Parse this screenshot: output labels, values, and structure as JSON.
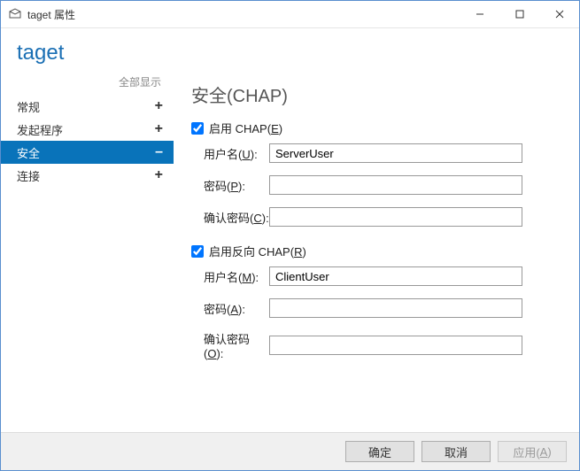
{
  "window": {
    "title": "taget 属性"
  },
  "heading": "taget",
  "sidebar": {
    "show_all": "全部显示",
    "items": [
      {
        "label": "常规",
        "toggle": "+",
        "active": false
      },
      {
        "label": "发起程序",
        "toggle": "+",
        "active": false
      },
      {
        "label": "安全",
        "toggle": "–",
        "active": true
      },
      {
        "label": "连接",
        "toggle": "+",
        "active": false
      }
    ]
  },
  "content": {
    "section_title": "安全(CHAP)",
    "chap": {
      "enable_label_pre": "启用 CHAP(",
      "enable_key": "E",
      "enable_label_post": ")",
      "enabled": true,
      "username_label_pre": "用户名(",
      "username_key": "U",
      "username_label_post": "):",
      "username_value": "ServerUser",
      "password_label_pre": "密码(",
      "password_key": "P",
      "password_label_post": "):",
      "password_value": "",
      "confirm_label_pre": "确认密码(",
      "confirm_key": "C",
      "confirm_label_post": "):",
      "confirm_value": ""
    },
    "rchap": {
      "enable_label_pre": "启用反向 CHAP(",
      "enable_key": "R",
      "enable_label_post": ")",
      "enabled": true,
      "username_label_pre": "用户名(",
      "username_key": "M",
      "username_label_post": "):",
      "username_value": "ClientUser",
      "password_label_pre": "密码(",
      "password_key": "A",
      "password_label_post": "):",
      "password_value": "",
      "confirm_label_pre": "确认密码(",
      "confirm_key": "O",
      "confirm_label_post": "):",
      "confirm_value": ""
    }
  },
  "footer": {
    "ok": "确定",
    "cancel": "取消",
    "apply_pre": "应用(",
    "apply_key": "A",
    "apply_post": ")"
  }
}
